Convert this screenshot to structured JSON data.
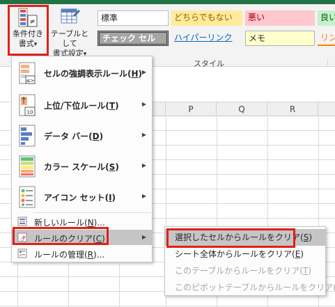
{
  "ribbon": {
    "conditional_format": {
      "line1": "条件付き",
      "line2": "書式",
      "dropdown": "▾"
    },
    "format_as_table": {
      "line1": "テーブルとして",
      "line2": "書式設定",
      "dropdown": "▾"
    },
    "styles_group_label": "スタイル",
    "cell_styles": [
      {
        "label": "標準",
        "bg": "#ffffff",
        "fg": "#000000"
      },
      {
        "label": "どちらでもない",
        "bg": "#ffeb9c",
        "fg": "#9c5700"
      },
      {
        "label": "悪い",
        "bg": "#ffc7ce",
        "fg": "#9c0006"
      },
      {
        "label": "良い",
        "bg": "#c6efce",
        "fg": "#006100"
      },
      {
        "label": "チェック セル",
        "bg": "#a5a5a5",
        "fg": "#ffffff"
      },
      {
        "label": "ハイパーリンク",
        "bg": "#ffffff",
        "fg": "#0563c1"
      },
      {
        "label": "メモ",
        "bg": "#ffffcc",
        "fg": "#000000"
      },
      {
        "label": "リン",
        "bg": "#ffffff",
        "fg": "#fa7d00"
      }
    ]
  },
  "sheet": {
    "columns": [
      "P",
      "Q",
      "R"
    ]
  },
  "menu": {
    "items": [
      {
        "label": "セルの強調表示ルール(",
        "key": "H",
        "end": ")"
      },
      {
        "label": "上位/下位ルール(",
        "key": "T",
        "end": ")"
      },
      {
        "label": "データ バー(",
        "key": "D",
        "end": ")"
      },
      {
        "label": "カラー スケール(",
        "key": "S",
        "end": ")"
      },
      {
        "label": "アイコン セット(",
        "key": "I",
        "end": ")"
      }
    ],
    "small_items": [
      {
        "label": "新しいルール(",
        "key": "N",
        "end": ")..."
      },
      {
        "label": "ルールのクリア(",
        "key": "C",
        "end": ")"
      },
      {
        "label": "ルールの管理(",
        "key": "R",
        "end": ")..."
      }
    ],
    "arrow": "▶"
  },
  "submenu": {
    "items": [
      {
        "label": "選択したセルからルールをクリア(",
        "key": "S",
        "end": ")"
      },
      {
        "label": "シート全体からルールをクリア(",
        "key": "E",
        "end": ")"
      },
      {
        "label": "このテーブルからルールをクリア(",
        "key": "T",
        "end": ")"
      },
      {
        "label": "このピボットテーブルからルールをクリア(",
        "key": "P",
        "end": ")"
      }
    ]
  },
  "colors": {
    "accent_green": "#217346",
    "highlight_red": "#e0201a",
    "menu_highlight": "#c5c5c5"
  }
}
